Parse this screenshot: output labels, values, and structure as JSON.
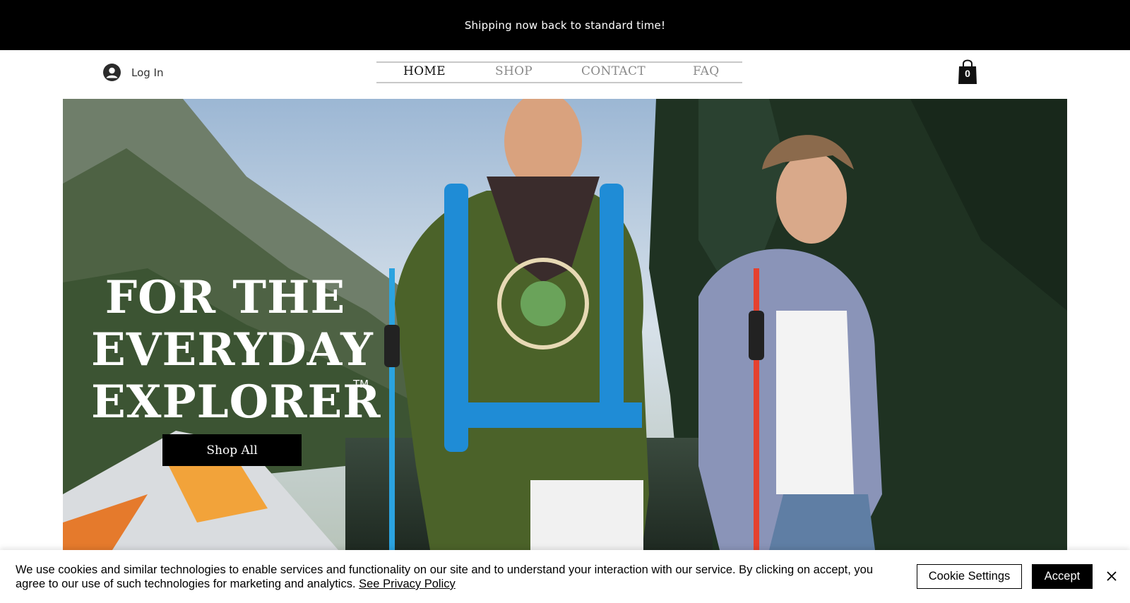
{
  "announcement": {
    "text": "Shipping now back to standard time!"
  },
  "header": {
    "login_label": "Log In",
    "nav": [
      {
        "label": "HOME",
        "active": true
      },
      {
        "label": "SHOP",
        "active": false
      },
      {
        "label": "CONTACT",
        "active": false
      },
      {
        "label": "FAQ",
        "active": false
      }
    ],
    "cart_count": "0"
  },
  "hero": {
    "title_lines": [
      "FOR THE",
      "EVERYDAY",
      "EXPLORER"
    ],
    "trademark": "TM",
    "cta_label": "Shop All",
    "image_description_icon": "hikers-photo"
  },
  "cookie_banner": {
    "text": "We use cookies and similar technologies to enable services and functionality on our site and to understand your interaction with our service. By clicking on accept, you agree to our use of such technologies for marketing and analytics.",
    "privacy_link": "See Privacy Policy",
    "settings_label": "Cookie Settings",
    "accept_label": "Accept"
  },
  "colors": {
    "announce_bg": "#000000",
    "nav_inactive": "#8a8a8a",
    "nav_active": "#111111",
    "button_bg": "#000000"
  }
}
